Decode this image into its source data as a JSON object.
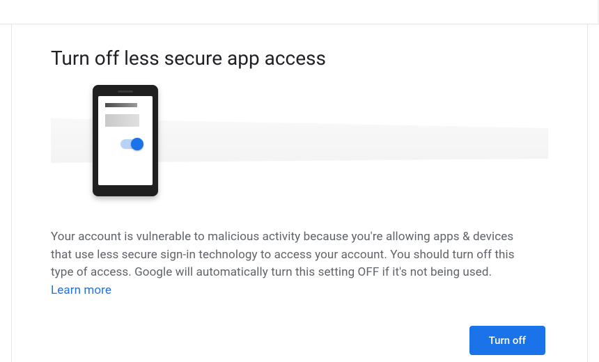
{
  "title": "Turn off less secure app access",
  "body_text": "Your account is vulnerable to malicious activity because you're allowing apps & devices that use less secure sign-in technology to access your account. You should turn off this type of access. Google will automatically turn this setting OFF if it's not being used. ",
  "learn_more_label": "Learn more",
  "primary_button_label": "Turn off",
  "colors": {
    "accent": "#1a73e8",
    "body": "#5f6368"
  }
}
